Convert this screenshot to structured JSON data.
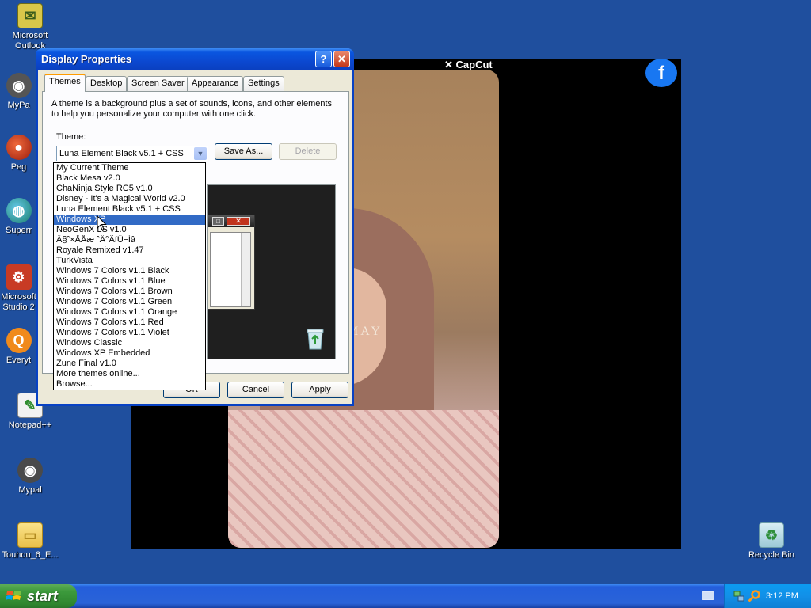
{
  "desktop": {
    "icons": [
      {
        "label": "Microsoft Outlook",
        "icon": "outlook-icon"
      },
      {
        "label": "MyPa",
        "icon": "mypal-icon"
      },
      {
        "label": "Peg",
        "icon": "pegasus-icon"
      },
      {
        "label": "Superr",
        "icon": "superr-icon"
      },
      {
        "label": "Microsoft Studio 2",
        "icon": "studio-icon"
      },
      {
        "label": "Everyt",
        "icon": "everything-icon"
      },
      {
        "label": "Notepad++",
        "icon": "notepadpp-icon"
      },
      {
        "label": "Mypal",
        "icon": "mypal-icon"
      },
      {
        "label": "Touhou_6_E...",
        "icon": "folder-icon"
      },
      {
        "label": "Recycle Bin",
        "icon": "recycle-bin-icon"
      }
    ]
  },
  "video": {
    "brand": "✕ CapCut",
    "overlay_text": "MAY",
    "facebook_logo": "f"
  },
  "dialog": {
    "title": "Display Properties",
    "help_glyph": "?",
    "close_glyph": "✕",
    "tabs": [
      {
        "label": "Themes",
        "active": true
      },
      {
        "label": "Desktop",
        "active": false
      },
      {
        "label": "Screen Saver",
        "active": false
      },
      {
        "label": "Appearance",
        "active": false
      },
      {
        "label": "Settings",
        "active": false
      }
    ],
    "intro": "A theme is a background plus a set of sounds, icons, and other elements to help you personalize your computer with one click.",
    "theme_label": "Theme:",
    "theme_value": "Luna Element Black v5.1 + CSS",
    "save_as_label": "Save As...",
    "delete_label": "Delete",
    "ok_label": "OK",
    "cancel_label": "Cancel",
    "apply_label": "Apply",
    "theme_options": [
      {
        "label": "My Current Theme",
        "selected": false
      },
      {
        "label": "Black Mesa v2.0",
        "selected": false
      },
      {
        "label": "ChaNinja Style RC5 v1.0",
        "selected": false
      },
      {
        "label": "Disney - It's a Magical World v2.0",
        "selected": false
      },
      {
        "label": "Luna Element Black v5.1 + CSS",
        "selected": false
      },
      {
        "label": "Windows XP",
        "selected": true
      },
      {
        "label": "NeoGenX LS v1.0",
        "selected": false
      },
      {
        "label": "Ä§ˆ×ÅÅæ ˆÄ°ÃíÜ÷Íâ",
        "selected": false
      },
      {
        "label": "Royale Remixed v1.47",
        "selected": false
      },
      {
        "label": "TurkVista",
        "selected": false
      },
      {
        "label": "Windows 7 Colors v1.1 Black",
        "selected": false
      },
      {
        "label": "Windows 7 Colors v1.1 Blue",
        "selected": false
      },
      {
        "label": "Windows 7 Colors v1.1 Brown",
        "selected": false
      },
      {
        "label": "Windows 7 Colors v1.1 Green",
        "selected": false
      },
      {
        "label": "Windows 7 Colors v1.1 Orange",
        "selected": false
      },
      {
        "label": "Windows 7 Colors v1.1 Red",
        "selected": false
      },
      {
        "label": "Windows 7 Colors v1.1 Violet",
        "selected": false
      },
      {
        "label": "Windows Classic",
        "selected": false
      },
      {
        "label": "Windows XP Embedded",
        "selected": false
      },
      {
        "label": "Zune Final v1.0",
        "selected": false
      },
      {
        "label": "More themes online...",
        "selected": false
      },
      {
        "label": "Browse...",
        "selected": false
      }
    ]
  },
  "taskbar": {
    "start_label": "start",
    "clock": "3:12 PM"
  },
  "colors": {
    "desktop_bg": "#1f4f9e",
    "titlebar": "#0a56e0",
    "selection": "#316ac5",
    "start_green": "#3c9a3c",
    "tray_blue": "#1290e8"
  }
}
